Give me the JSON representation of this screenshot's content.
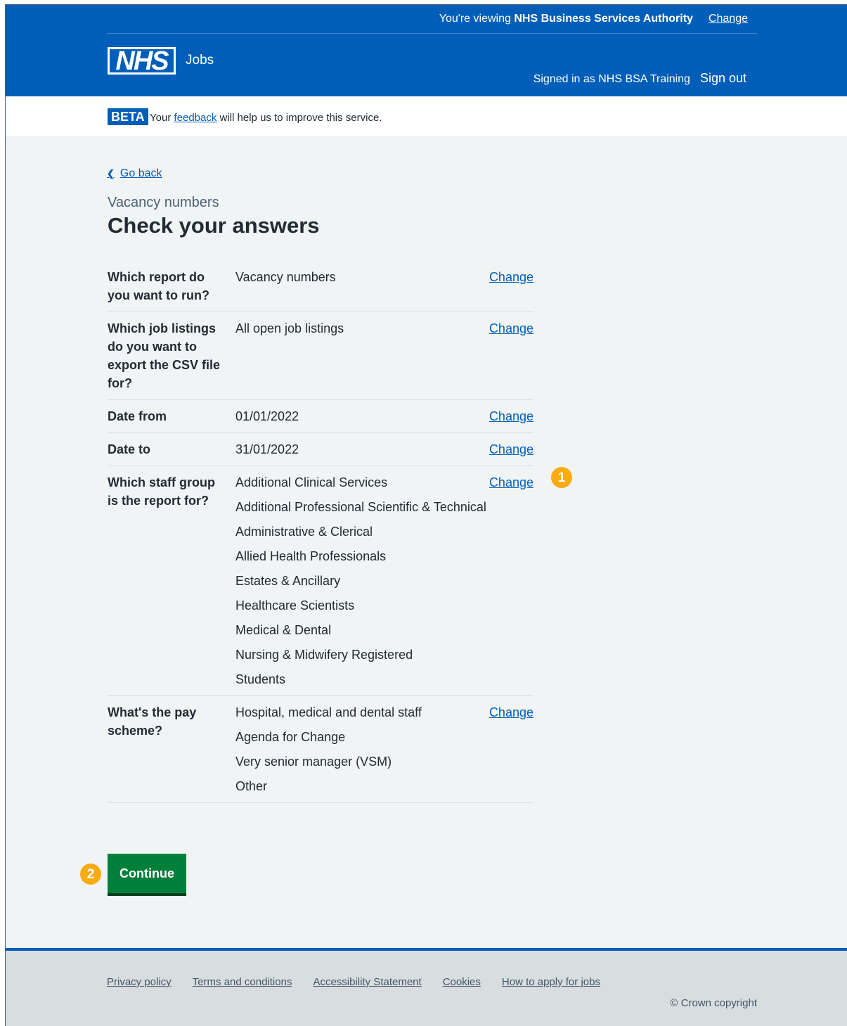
{
  "header": {
    "viewing_prefix": "You're viewing",
    "organisation": "NHS Business Services Authority",
    "change_org_label": "Change",
    "logo_text": "NHS",
    "service_name": "Jobs",
    "signed_in_text": "Signed in as NHS BSA Training",
    "sign_out_label": "Sign out",
    "brand_color": "#005eb8"
  },
  "beta": {
    "tag": "BETA",
    "text_before": "Your",
    "link": "feedback",
    "text_after": "will help us to improve this service."
  },
  "nav": {
    "back_label": "Go back"
  },
  "page": {
    "caption": "Vacancy numbers",
    "title": "Check your answers"
  },
  "summary": {
    "rows": [
      {
        "key": "Which report do you want to run?",
        "values": [
          "Vacancy numbers"
        ],
        "action": "Change"
      },
      {
        "key": "Which job listings do you want to export the CSV file for?",
        "values": [
          "All open job listings"
        ],
        "action": "Change"
      },
      {
        "key": "Date from",
        "values": [
          "01/01/2022"
        ],
        "action": "Change"
      },
      {
        "key": "Date to",
        "values": [
          "31/01/2022"
        ],
        "action": "Change"
      },
      {
        "key": "Which staff group is the report for?",
        "values": [
          "Additional Clinical Services",
          "Additional Professional Scientific & Technical",
          "Administrative & Clerical",
          "Allied Health Professionals",
          "Estates & Ancillary",
          "Healthcare Scientists",
          "Medical & Dental",
          "Nursing & Midwifery Registered",
          "Students"
        ],
        "action": "Change"
      },
      {
        "key": "What's the pay scheme?",
        "values": [
          "Hospital, medical and dental staff",
          "Agenda for Change",
          "Very senior manager (VSM)",
          "Other"
        ],
        "action": "Change"
      }
    ]
  },
  "markers": {
    "one": "1",
    "two": "2",
    "color": "#f9ab11"
  },
  "continue_label": "Continue",
  "footer": {
    "links": [
      "Privacy policy",
      "Terms and conditions",
      "Accessibility Statement",
      "Cookies",
      "How to apply for jobs"
    ],
    "copyright": "© Crown copyright"
  }
}
